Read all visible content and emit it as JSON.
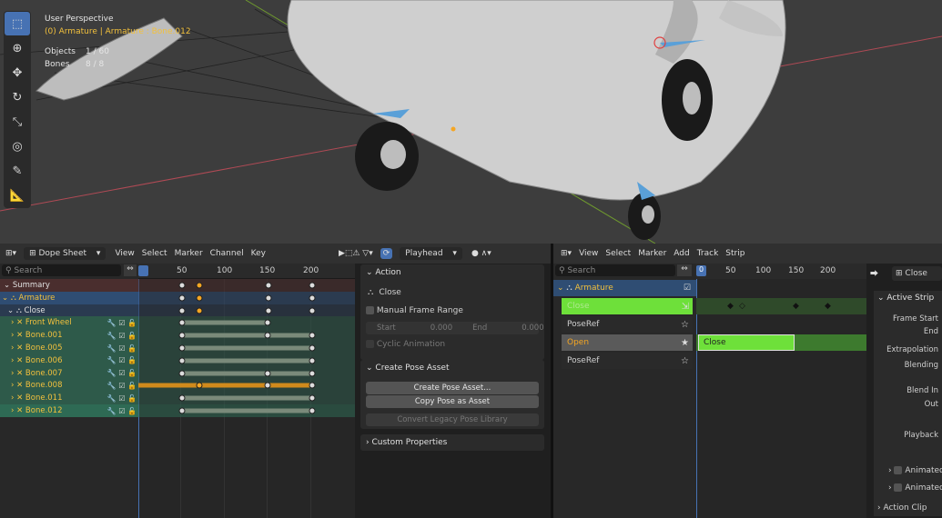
{
  "viewport": {
    "perspective": "User Perspective",
    "selection": "(0) Armature | Armature : Bone.012",
    "stats": [
      {
        "label": "Objects",
        "value": "1 / 60"
      },
      {
        "label": "Bones",
        "value": "8 / 8"
      }
    ],
    "tools": [
      "select-box-icon",
      "cursor-icon",
      "move-icon",
      "rotate-icon",
      "scale-icon",
      "transform-icon",
      "annotate-icon",
      "measure-icon"
    ]
  },
  "dopesheet": {
    "editor_mode": "Dope Sheet",
    "menus": [
      "View",
      "Select",
      "Marker",
      "Channel",
      "Key"
    ],
    "playhead_label": "Playhead",
    "search_placeholder": "Search",
    "ruler": [
      "50",
      "100",
      "150",
      "200"
    ],
    "channels": [
      {
        "name": "Summary",
        "kind": "summary",
        "keys": [
          50,
          70,
          150,
          200
        ],
        "sel": [
          70
        ]
      },
      {
        "name": "Armature",
        "kind": "object",
        "keys": [
          50,
          70,
          150,
          200
        ],
        "sel": [
          70
        ]
      },
      {
        "name": "Close",
        "kind": "action",
        "keys": [
          50,
          70,
          150,
          200
        ],
        "sel": [
          70
        ]
      },
      {
        "name": "Front Wheel",
        "kind": "bone",
        "keys": [
          50,
          149
        ],
        "sel": []
      },
      {
        "name": "Bone.001",
        "kind": "bone",
        "keys": [
          50,
          149,
          200
        ],
        "sel": []
      },
      {
        "name": "Bone.005",
        "kind": "bone",
        "keys": [
          50,
          200
        ],
        "sel": []
      },
      {
        "name": "Bone.006",
        "kind": "bone",
        "keys": [
          50,
          200
        ],
        "sel": []
      },
      {
        "name": "Bone.007",
        "kind": "bone",
        "keys": [
          50,
          149,
          200
        ],
        "sel": []
      },
      {
        "name": "Bone.008",
        "kind": "bone",
        "keys": [
          70,
          149,
          200
        ],
        "sel": [
          70
        ]
      },
      {
        "name": "Bone.011",
        "kind": "bone",
        "keys": [
          50,
          200
        ],
        "sel": []
      },
      {
        "name": "Bone.012",
        "kind": "bone-active",
        "keys": [
          50,
          200
        ],
        "sel": []
      }
    ]
  },
  "action_panel": {
    "title": "Action",
    "action_name": "Close",
    "manual_frame_range": "Manual Frame Range",
    "start_label": "Start",
    "start_value": "0.000",
    "end_label": "End",
    "end_value": "0.000",
    "cyclic": "Cyclic Animation",
    "pose_asset_title": "Create Pose Asset",
    "create_pose_asset": "Create Pose Asset...",
    "copy_pose_asset": "Copy Pose as Asset",
    "convert_legacy": "Convert Legacy Pose Library",
    "custom_properties": "Custom Properties"
  },
  "nla": {
    "menus": [
      "View",
      "Select",
      "Marker",
      "Add",
      "Track",
      "Strip"
    ],
    "search_placeholder": "Search",
    "frame_current": "0",
    "ruler": [
      "50",
      "100",
      "150",
      "200"
    ],
    "object": "Armature",
    "tracks": [
      {
        "name": "Close",
        "kind": "action-green"
      },
      {
        "name": "PoseRef",
        "kind": "track"
      },
      {
        "name": "Open",
        "kind": "track-active"
      },
      {
        "name": "PoseRef",
        "kind": "track"
      }
    ],
    "strip_label": "Close"
  },
  "strip_props": {
    "strip_name": "Close",
    "active_strip": "Active Strip",
    "frame_start": "Frame Start",
    "end": "End",
    "extrapolation": "Extrapolation",
    "blending": "Blending",
    "blend_in": "Blend In",
    "out": "Out",
    "playback": "Playback",
    "animated_1": "Animated",
    "animated_2": "Animated",
    "action_clip": "Action Clip"
  },
  "colors": {
    "accent": "#4772b3",
    "selection_yellow": "#f2c03d",
    "key_selected": "#f5a623",
    "bone_row": "#2e5a4a",
    "strip_green": "#6ee03a",
    "armature_row": "#2f4d73"
  }
}
